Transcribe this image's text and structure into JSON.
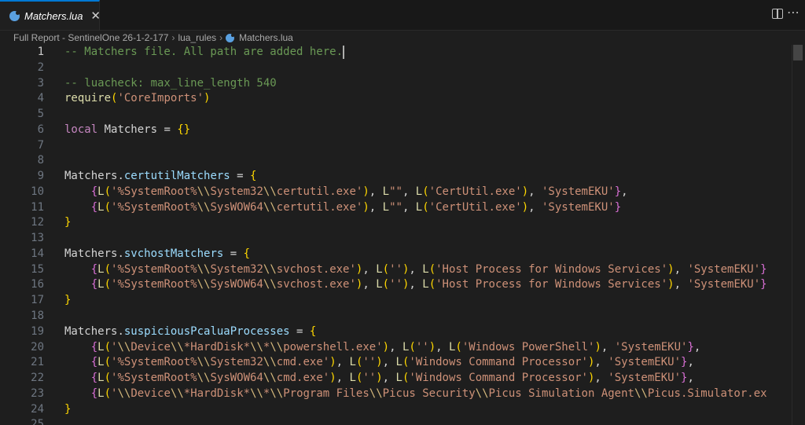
{
  "tab": {
    "label": "Matchers.lua",
    "close": "✕"
  },
  "breadcrumb": {
    "parts": [
      "Full Report - SentinelOne 26-1-2-177",
      "lua_rules",
      "Matchers.lua"
    ]
  },
  "line_numbers": [
    "1",
    "2",
    "3",
    "4",
    "5",
    "6",
    "7",
    "8",
    "9",
    "10",
    "11",
    "12",
    "13",
    "14",
    "15",
    "16",
    "17",
    "18",
    "19",
    "20",
    "21",
    "22",
    "23",
    "24",
    "25"
  ],
  "active_line": "1",
  "code": [
    [
      {
        "t": "-- Matchers file. All path are added here.",
        "c": "t-c"
      }
    ],
    [],
    [
      {
        "t": "-- luacheck: max_line_length 540",
        "c": "t-c"
      }
    ],
    [
      {
        "t": "require",
        "c": "t-f"
      },
      {
        "t": "(",
        "c": "t-p"
      },
      {
        "t": "'CoreImports'",
        "c": "t-s"
      },
      {
        "t": ")",
        "c": "t-p"
      }
    ],
    [],
    [
      {
        "t": "local",
        "c": "t-k"
      },
      {
        "t": " Matchers ",
        "c": "t-o"
      },
      {
        "t": "=",
        "c": "t-o"
      },
      {
        "t": " ",
        "c": "t-o"
      },
      {
        "t": "{}",
        "c": "t-p"
      }
    ],
    [],
    [],
    [
      {
        "t": "Matchers",
        "c": "t-o"
      },
      {
        "t": ".",
        "c": "t-o"
      },
      {
        "t": "certutilMatchers",
        "c": "t-v"
      },
      {
        "t": " = ",
        "c": "t-o"
      },
      {
        "t": "{",
        "c": "t-p"
      }
    ],
    [
      {
        "t": "    ",
        "c": "t-o"
      },
      {
        "t": "{",
        "c": "t-b"
      },
      {
        "t": "L",
        "c": "t-f"
      },
      {
        "t": "(",
        "c": "t-p"
      },
      {
        "t": "'%SystemRoot%",
        "c": "t-s"
      },
      {
        "t": "\\\\",
        "c": "t-e"
      },
      {
        "t": "System32",
        "c": "t-s"
      },
      {
        "t": "\\\\",
        "c": "t-e"
      },
      {
        "t": "certutil.exe'",
        "c": "t-s"
      },
      {
        "t": ")",
        "c": "t-p"
      },
      {
        "t": ", ",
        "c": "t-o"
      },
      {
        "t": "L",
        "c": "t-f"
      },
      {
        "t": "\"\"",
        "c": "t-s"
      },
      {
        "t": ", ",
        "c": "t-o"
      },
      {
        "t": "L",
        "c": "t-f"
      },
      {
        "t": "(",
        "c": "t-p"
      },
      {
        "t": "'CertUtil.exe'",
        "c": "t-s"
      },
      {
        "t": ")",
        "c": "t-p"
      },
      {
        "t": ", ",
        "c": "t-o"
      },
      {
        "t": "'SystemEKU'",
        "c": "t-s"
      },
      {
        "t": "}",
        "c": "t-b"
      },
      {
        "t": ",",
        "c": "t-o"
      }
    ],
    [
      {
        "t": "    ",
        "c": "t-o"
      },
      {
        "t": "{",
        "c": "t-b"
      },
      {
        "t": "L",
        "c": "t-f"
      },
      {
        "t": "(",
        "c": "t-p"
      },
      {
        "t": "'%SystemRoot%",
        "c": "t-s"
      },
      {
        "t": "\\\\",
        "c": "t-e"
      },
      {
        "t": "SysWOW64",
        "c": "t-s"
      },
      {
        "t": "\\\\",
        "c": "t-e"
      },
      {
        "t": "certutil.exe'",
        "c": "t-s"
      },
      {
        "t": ")",
        "c": "t-p"
      },
      {
        "t": ", ",
        "c": "t-o"
      },
      {
        "t": "L",
        "c": "t-f"
      },
      {
        "t": "\"\"",
        "c": "t-s"
      },
      {
        "t": ", ",
        "c": "t-o"
      },
      {
        "t": "L",
        "c": "t-f"
      },
      {
        "t": "(",
        "c": "t-p"
      },
      {
        "t": "'CertUtil.exe'",
        "c": "t-s"
      },
      {
        "t": ")",
        "c": "t-p"
      },
      {
        "t": ", ",
        "c": "t-o"
      },
      {
        "t": "'SystemEKU'",
        "c": "t-s"
      },
      {
        "t": "}",
        "c": "t-b"
      }
    ],
    [
      {
        "t": "}",
        "c": "t-p"
      }
    ],
    [],
    [
      {
        "t": "Matchers",
        "c": "t-o"
      },
      {
        "t": ".",
        "c": "t-o"
      },
      {
        "t": "svchostMatchers",
        "c": "t-v"
      },
      {
        "t": " = ",
        "c": "t-o"
      },
      {
        "t": "{",
        "c": "t-p"
      }
    ],
    [
      {
        "t": "    ",
        "c": "t-o"
      },
      {
        "t": "{",
        "c": "t-b"
      },
      {
        "t": "L",
        "c": "t-f"
      },
      {
        "t": "(",
        "c": "t-p"
      },
      {
        "t": "'%SystemRoot%",
        "c": "t-s"
      },
      {
        "t": "\\\\",
        "c": "t-e"
      },
      {
        "t": "System32",
        "c": "t-s"
      },
      {
        "t": "\\\\",
        "c": "t-e"
      },
      {
        "t": "svchost.exe'",
        "c": "t-s"
      },
      {
        "t": ")",
        "c": "t-p"
      },
      {
        "t": ", ",
        "c": "t-o"
      },
      {
        "t": "L",
        "c": "t-f"
      },
      {
        "t": "(",
        "c": "t-p"
      },
      {
        "t": "''",
        "c": "t-s"
      },
      {
        "t": ")",
        "c": "t-p"
      },
      {
        "t": ", ",
        "c": "t-o"
      },
      {
        "t": "L",
        "c": "t-f"
      },
      {
        "t": "(",
        "c": "t-p"
      },
      {
        "t": "'Host Process for Windows Services'",
        "c": "t-s"
      },
      {
        "t": ")",
        "c": "t-p"
      },
      {
        "t": ", ",
        "c": "t-o"
      },
      {
        "t": "'SystemEKU'",
        "c": "t-s"
      },
      {
        "t": "}",
        "c": "t-b"
      }
    ],
    [
      {
        "t": "    ",
        "c": "t-o"
      },
      {
        "t": "{",
        "c": "t-b"
      },
      {
        "t": "L",
        "c": "t-f"
      },
      {
        "t": "(",
        "c": "t-p"
      },
      {
        "t": "'%SystemRoot%",
        "c": "t-s"
      },
      {
        "t": "\\\\",
        "c": "t-e"
      },
      {
        "t": "SysWOW64",
        "c": "t-s"
      },
      {
        "t": "\\\\",
        "c": "t-e"
      },
      {
        "t": "svchost.exe'",
        "c": "t-s"
      },
      {
        "t": ")",
        "c": "t-p"
      },
      {
        "t": ", ",
        "c": "t-o"
      },
      {
        "t": "L",
        "c": "t-f"
      },
      {
        "t": "(",
        "c": "t-p"
      },
      {
        "t": "''",
        "c": "t-s"
      },
      {
        "t": ")",
        "c": "t-p"
      },
      {
        "t": ", ",
        "c": "t-o"
      },
      {
        "t": "L",
        "c": "t-f"
      },
      {
        "t": "(",
        "c": "t-p"
      },
      {
        "t": "'Host Process for Windows Services'",
        "c": "t-s"
      },
      {
        "t": ")",
        "c": "t-p"
      },
      {
        "t": ", ",
        "c": "t-o"
      },
      {
        "t": "'SystemEKU'",
        "c": "t-s"
      },
      {
        "t": "}",
        "c": "t-b"
      }
    ],
    [
      {
        "t": "}",
        "c": "t-p"
      }
    ],
    [],
    [
      {
        "t": "Matchers",
        "c": "t-o"
      },
      {
        "t": ".",
        "c": "t-o"
      },
      {
        "t": "suspiciousPcaluaProcesses",
        "c": "t-v"
      },
      {
        "t": " = ",
        "c": "t-o"
      },
      {
        "t": "{",
        "c": "t-p"
      }
    ],
    [
      {
        "t": "    ",
        "c": "t-o"
      },
      {
        "t": "{",
        "c": "t-b"
      },
      {
        "t": "L",
        "c": "t-f"
      },
      {
        "t": "(",
        "c": "t-p"
      },
      {
        "t": "'",
        "c": "t-s"
      },
      {
        "t": "\\\\",
        "c": "t-e"
      },
      {
        "t": "Device",
        "c": "t-s"
      },
      {
        "t": "\\\\",
        "c": "t-e"
      },
      {
        "t": "*HardDisk*",
        "c": "t-s"
      },
      {
        "t": "\\\\",
        "c": "t-e"
      },
      {
        "t": "*",
        "c": "t-s"
      },
      {
        "t": "\\\\",
        "c": "t-e"
      },
      {
        "t": "powershell.exe'",
        "c": "t-s"
      },
      {
        "t": ")",
        "c": "t-p"
      },
      {
        "t": ", ",
        "c": "t-o"
      },
      {
        "t": "L",
        "c": "t-f"
      },
      {
        "t": "(",
        "c": "t-p"
      },
      {
        "t": "''",
        "c": "t-s"
      },
      {
        "t": ")",
        "c": "t-p"
      },
      {
        "t": ", ",
        "c": "t-o"
      },
      {
        "t": "L",
        "c": "t-f"
      },
      {
        "t": "(",
        "c": "t-p"
      },
      {
        "t": "'Windows PowerShell'",
        "c": "t-s"
      },
      {
        "t": ")",
        "c": "t-p"
      },
      {
        "t": ", ",
        "c": "t-o"
      },
      {
        "t": "'SystemEKU'",
        "c": "t-s"
      },
      {
        "t": "}",
        "c": "t-b"
      },
      {
        "t": ",",
        "c": "t-o"
      }
    ],
    [
      {
        "t": "    ",
        "c": "t-o"
      },
      {
        "t": "{",
        "c": "t-b"
      },
      {
        "t": "L",
        "c": "t-f"
      },
      {
        "t": "(",
        "c": "t-p"
      },
      {
        "t": "'%SystemRoot%",
        "c": "t-s"
      },
      {
        "t": "\\\\",
        "c": "t-e"
      },
      {
        "t": "System32",
        "c": "t-s"
      },
      {
        "t": "\\\\",
        "c": "t-e"
      },
      {
        "t": "cmd.exe'",
        "c": "t-s"
      },
      {
        "t": ")",
        "c": "t-p"
      },
      {
        "t": ", ",
        "c": "t-o"
      },
      {
        "t": "L",
        "c": "t-f"
      },
      {
        "t": "(",
        "c": "t-p"
      },
      {
        "t": "''",
        "c": "t-s"
      },
      {
        "t": ")",
        "c": "t-p"
      },
      {
        "t": ", ",
        "c": "t-o"
      },
      {
        "t": "L",
        "c": "t-f"
      },
      {
        "t": "(",
        "c": "t-p"
      },
      {
        "t": "'Windows Command Processor'",
        "c": "t-s"
      },
      {
        "t": ")",
        "c": "t-p"
      },
      {
        "t": ", ",
        "c": "t-o"
      },
      {
        "t": "'SystemEKU'",
        "c": "t-s"
      },
      {
        "t": "}",
        "c": "t-b"
      },
      {
        "t": ",",
        "c": "t-o"
      }
    ],
    [
      {
        "t": "    ",
        "c": "t-o"
      },
      {
        "t": "{",
        "c": "t-b"
      },
      {
        "t": "L",
        "c": "t-f"
      },
      {
        "t": "(",
        "c": "t-p"
      },
      {
        "t": "'%SystemRoot%",
        "c": "t-s"
      },
      {
        "t": "\\\\",
        "c": "t-e"
      },
      {
        "t": "SysWOW64",
        "c": "t-s"
      },
      {
        "t": "\\\\",
        "c": "t-e"
      },
      {
        "t": "cmd.exe'",
        "c": "t-s"
      },
      {
        "t": ")",
        "c": "t-p"
      },
      {
        "t": ", ",
        "c": "t-o"
      },
      {
        "t": "L",
        "c": "t-f"
      },
      {
        "t": "(",
        "c": "t-p"
      },
      {
        "t": "''",
        "c": "t-s"
      },
      {
        "t": ")",
        "c": "t-p"
      },
      {
        "t": ", ",
        "c": "t-o"
      },
      {
        "t": "L",
        "c": "t-f"
      },
      {
        "t": "(",
        "c": "t-p"
      },
      {
        "t": "'Windows Command Processor'",
        "c": "t-s"
      },
      {
        "t": ")",
        "c": "t-p"
      },
      {
        "t": ", ",
        "c": "t-o"
      },
      {
        "t": "'SystemEKU'",
        "c": "t-s"
      },
      {
        "t": "}",
        "c": "t-b"
      },
      {
        "t": ",",
        "c": "t-o"
      }
    ],
    [
      {
        "t": "    ",
        "c": "t-o"
      },
      {
        "t": "{",
        "c": "t-b"
      },
      {
        "t": "L",
        "c": "t-f"
      },
      {
        "t": "(",
        "c": "t-p"
      },
      {
        "t": "'",
        "c": "t-s"
      },
      {
        "t": "\\\\",
        "c": "t-e"
      },
      {
        "t": "Device",
        "c": "t-s"
      },
      {
        "t": "\\\\",
        "c": "t-e"
      },
      {
        "t": "*HardDisk*",
        "c": "t-s"
      },
      {
        "t": "\\\\",
        "c": "t-e"
      },
      {
        "t": "*",
        "c": "t-s"
      },
      {
        "t": "\\\\",
        "c": "t-e"
      },
      {
        "t": "Program Files",
        "c": "t-s"
      },
      {
        "t": "\\\\",
        "c": "t-e"
      },
      {
        "t": "Picus Security",
        "c": "t-s"
      },
      {
        "t": "\\\\",
        "c": "t-e"
      },
      {
        "t": "Picus Simulation Agent",
        "c": "t-s"
      },
      {
        "t": "\\\\",
        "c": "t-e"
      },
      {
        "t": "Picus.Simulator.ex",
        "c": "t-s"
      }
    ],
    [
      {
        "t": "}",
        "c": "t-p"
      }
    ],
    []
  ]
}
